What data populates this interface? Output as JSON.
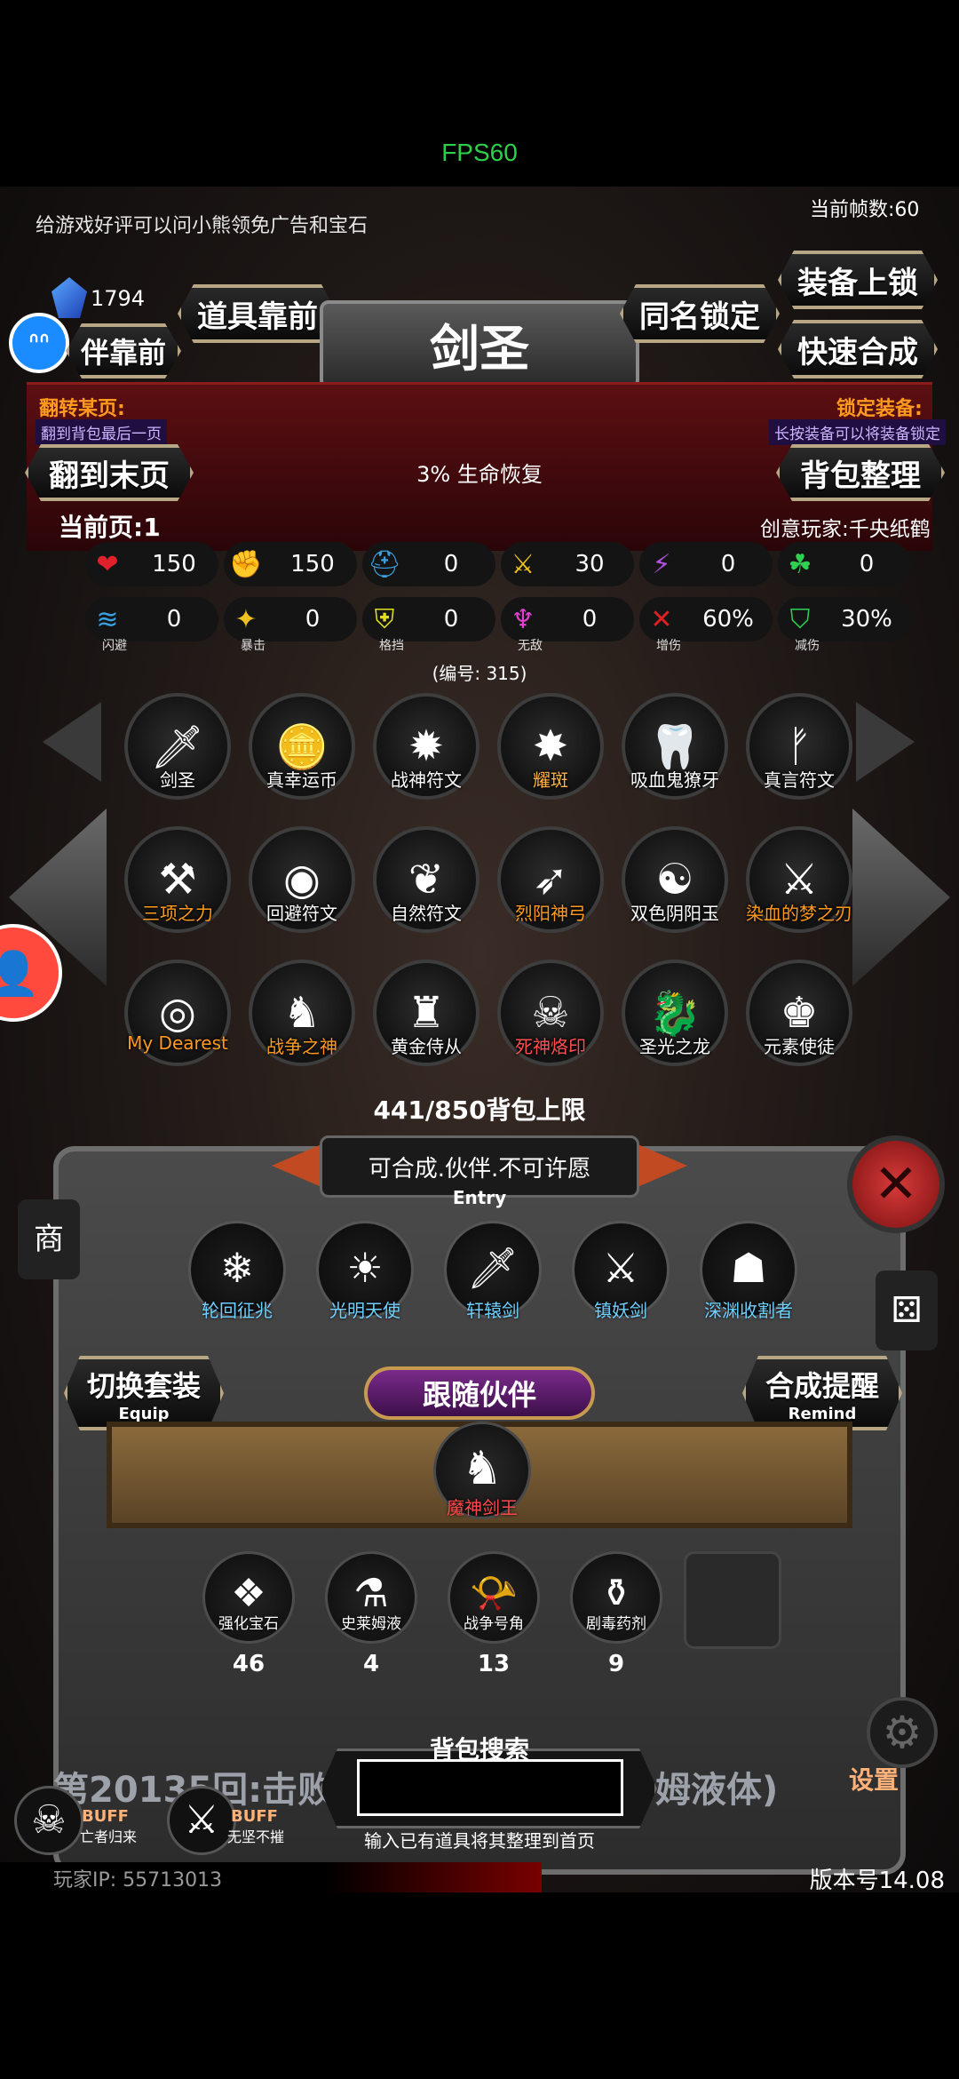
{
  "status": {
    "fps": "FPS60"
  },
  "top": {
    "tip": "给游戏好评可以问小熊领免广告和宝石",
    "frames": "当前帧数:60",
    "gem_count": "1794"
  },
  "buttons": {
    "partner_front": "伴靠前",
    "item_front": "道具靠前",
    "same_name_lock": "同名锁定",
    "equip_lock": "装备上锁",
    "quick_merge": "快速合成",
    "go_last_page": "翻到末页",
    "bag_sort": "背包整理",
    "switch_set": "切换套装",
    "switch_set_sub": "Equip",
    "merge_remind": "合成提醒",
    "merge_remind_sub": "Remind"
  },
  "title": "剑圣",
  "notes": {
    "flip_title": "翻转某页:",
    "flip_desc": "翻到背包最后一页",
    "lock_title": "锁定装备:",
    "lock_desc": "长按装备可以将装备锁定",
    "effect": "3% 生命恢复",
    "current_page": "当前页:1",
    "creator": "创意玩家:千央纸鹤",
    "serial": "(编号: 315)"
  },
  "stats_row1": [
    {
      "icon": "heart-icon",
      "glyph": "❤",
      "color": "#e0202a",
      "value": "150"
    },
    {
      "icon": "strength-icon",
      "glyph": "✊",
      "color": "#f0c020",
      "value": "150"
    },
    {
      "icon": "helmet-icon",
      "glyph": "⛑",
      "color": "#3aa0e0",
      "value": "0"
    },
    {
      "icon": "sword-icon",
      "glyph": "⚔",
      "color": "#f0c020",
      "value": "30"
    },
    {
      "icon": "lightning-icon",
      "glyph": "⚡",
      "color": "#b050e0",
      "value": "0"
    },
    {
      "icon": "clover-icon",
      "glyph": "☘",
      "color": "#30d050",
      "value": "0"
    }
  ],
  "stats_row2": [
    {
      "icon": "dodge-icon",
      "glyph": "≋",
      "color": "#3aa0e0",
      "value": "0",
      "caption": "闪避"
    },
    {
      "icon": "crit-icon",
      "glyph": "✦",
      "color": "#f0c020",
      "value": "0",
      "caption": "暴击"
    },
    {
      "icon": "block-icon",
      "glyph": "⛨",
      "color": "#e0e020",
      "value": "0",
      "caption": "格挡"
    },
    {
      "icon": "invincible-icon",
      "glyph": "♆",
      "color": "#e040d0",
      "value": "0",
      "caption": "无敌"
    },
    {
      "icon": "damage-up-icon",
      "glyph": "✕",
      "color": "#e02020",
      "value": "60%",
      "caption": "增伤"
    },
    {
      "icon": "damage-reduce-icon",
      "glyph": "⛉",
      "color": "#30d050",
      "value": "30%",
      "caption": "减伤"
    }
  ],
  "items": [
    {
      "name": "剑圣",
      "color": "#ffffff",
      "glyph": "🗡"
    },
    {
      "name": "真幸运币",
      "color": "#ffffff",
      "glyph": "🪙"
    },
    {
      "name": "战神符文",
      "color": "#ffffff",
      "glyph": "✹"
    },
    {
      "name": "耀斑",
      "color": "#ffb347",
      "glyph": "✸"
    },
    {
      "name": "吸血鬼獠牙",
      "color": "#ffffff",
      "glyph": "🦷"
    },
    {
      "name": "真言符文",
      "color": "#ffffff",
      "glyph": "ᚠ"
    },
    {
      "name": "三项之力",
      "color": "#ff9a1f",
      "glyph": "⚒"
    },
    {
      "name": "回避符文",
      "color": "#ffffff",
      "glyph": "◉"
    },
    {
      "name": "自然符文",
      "color": "#ffffff",
      "glyph": "❦"
    },
    {
      "name": "烈阳神弓",
      "color": "#ff9a1f",
      "glyph": "➶"
    },
    {
      "name": "双色阴阳玉",
      "color": "#ffffff",
      "glyph": "☯"
    },
    {
      "name": "染血的梦之刃",
      "color": "#ff9a1f",
      "glyph": "⚔"
    },
    {
      "name": "My Dearest",
      "color": "#ff9a1f",
      "glyph": "◎"
    },
    {
      "name": "战争之神",
      "color": "#ff9a1f",
      "glyph": "♞"
    },
    {
      "name": "黄金侍从",
      "color": "#ffffff",
      "glyph": "♜"
    },
    {
      "name": "死神烙印",
      "color": "#ff5050",
      "glyph": "☠"
    },
    {
      "name": "圣光之龙",
      "color": "#ffffff",
      "glyph": "🐉"
    },
    {
      "name": "元素使徒",
      "color": "#ffffff",
      "glyph": "♚"
    }
  ],
  "bag_limit": "441/850背包上限",
  "entry": {
    "text": "可合成.伙伴.不可许愿",
    "sub": "Entry"
  },
  "components": [
    {
      "name": "轮回征兆",
      "glyph": "❄"
    },
    {
      "name": "光明天使",
      "glyph": "☀"
    },
    {
      "name": "轩辕剑",
      "glyph": "🗡"
    },
    {
      "name": "镇妖剑",
      "glyph": "⚔"
    },
    {
      "name": "深渊收割者",
      "glyph": "☗"
    }
  ],
  "follow": {
    "label": "跟随伙伴",
    "partner_name": "魔神剑王"
  },
  "materials": [
    {
      "name": "强化宝石",
      "glyph": "❖",
      "count": "46"
    },
    {
      "name": "史莱姆液",
      "glyph": "⚗",
      "count": "4"
    },
    {
      "name": "战争号角",
      "glyph": "📯",
      "count": "13"
    },
    {
      "name": "剧毒药剂",
      "glyph": "⚱",
      "count": "9"
    }
  ],
  "search": {
    "label": "背包搜索",
    "hint": "输入已有道具将其整理到首页",
    "placeholder": ""
  },
  "log": {
    "left": "第20135回:击败史",
    "right": "姆液体)"
  },
  "buffs": [
    {
      "name": "BUFF",
      "sub": "亡者归来"
    },
    {
      "name": "BUFF",
      "sub": "无坚不摧"
    }
  ],
  "footer": {
    "ip": "玩家IP: 55713013",
    "version": "版本号14.08",
    "settings": "设置",
    "shop": "商"
  }
}
